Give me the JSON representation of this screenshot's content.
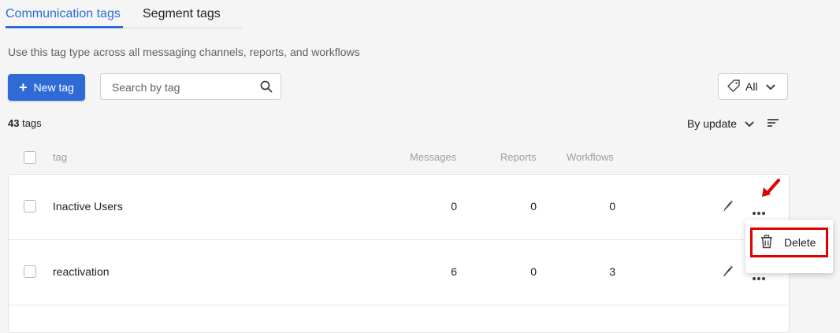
{
  "tabs": [
    {
      "label": "Communication tags",
      "active": true
    },
    {
      "label": "Segment tags",
      "active": false
    }
  ],
  "description": "Use this tag type across all messaging channels, reports, and workflows",
  "toolbar": {
    "new_tag_label": "New tag",
    "search_placeholder": "Search by tag",
    "filter_label": "All"
  },
  "summary": {
    "count": "43",
    "count_suffix": " tags"
  },
  "sort": {
    "label": "By update"
  },
  "table": {
    "headers": {
      "tag": "tag",
      "messages": "Messages",
      "reports": "Reports",
      "workflows": "Workflows"
    },
    "rows": [
      {
        "tag": "Inactive Users",
        "messages": "0",
        "reports": "0",
        "workflows": "0"
      },
      {
        "tag": "reactivation",
        "messages": "6",
        "reports": "0",
        "workflows": "3"
      }
    ]
  },
  "context_menu": {
    "delete_label": "Delete"
  },
  "colors": {
    "accent": "#2f6bd6",
    "highlight": "#e00000"
  },
  "icons": [
    "search-icon",
    "tag-icon",
    "chevron-down-icon",
    "sort-icon",
    "pencil-icon",
    "more-icon",
    "trash-icon",
    "plus-icon",
    "arrow-annotation-icon"
  ]
}
